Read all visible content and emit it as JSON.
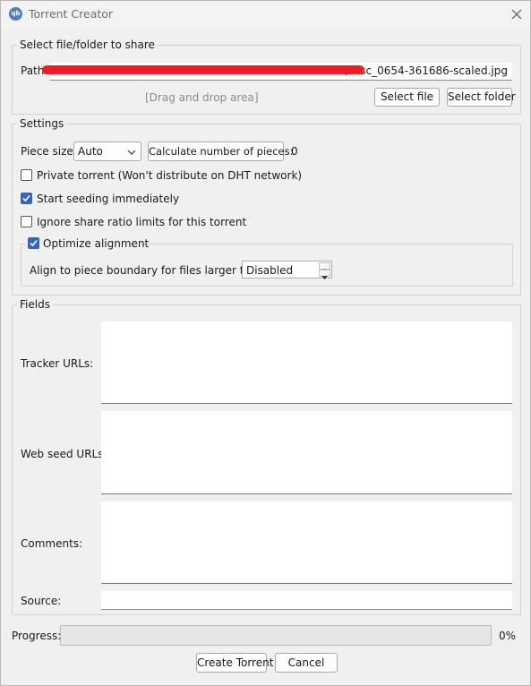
{
  "window": {
    "title": "Torrent Creator",
    "app_icon_text": "qb"
  },
  "share": {
    "group_title": "Select file/folder to share",
    "path_label": "Path:",
    "path_value": "s\\xdsc_0654-361686-scaled.jpg",
    "drag_drop_text": "[Drag and drop area]",
    "select_file_label": "Select file",
    "select_folder_label": "Select folder"
  },
  "settings": {
    "group_title": "Settings",
    "piece_size_label": "Piece size:",
    "piece_size_value": "Auto",
    "calc_pieces_label": "Calculate number of pieces:",
    "pieces_count": "0",
    "private_torrent_label": "Private torrent (Won't distribute on DHT network)",
    "private_torrent_checked": false,
    "start_seeding_label": "Start seeding immediately",
    "start_seeding_checked": true,
    "ignore_ratio_label": "Ignore share ratio limits for this torrent",
    "ignore_ratio_checked": false,
    "optimize_alignment_label": "Optimize alignment",
    "optimize_alignment_checked": true,
    "align_label": "Align to piece boundary for files larger than:",
    "align_value": "Disabled"
  },
  "fields": {
    "group_title": "Fields",
    "tracker_urls_label": "Tracker URLs:",
    "web_seed_urls_label": "Web seed URLs:",
    "comments_label": "Comments:",
    "source_label": "Source:"
  },
  "progress": {
    "label": "Progress:",
    "value_text": "0%",
    "fraction": 0.0
  },
  "actions": {
    "create_label": "Create Torrent",
    "cancel_label": "Cancel"
  },
  "colors": {
    "check_accent": "#2f66c5",
    "redaction": "#ee1c25"
  }
}
